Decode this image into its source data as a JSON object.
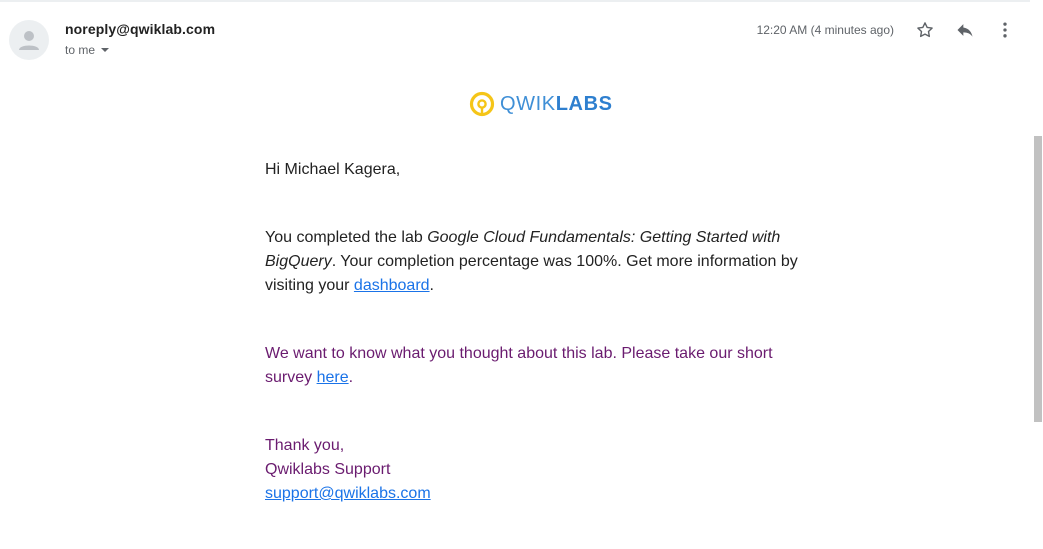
{
  "header": {
    "sender": "noreply@qwiklab.com",
    "recipient": "to me",
    "timestamp": "12:20 AM (4 minutes ago)",
    "icons": [
      "person-icon",
      "chevron-down-icon",
      "star-icon",
      "reply-icon",
      "more-vert-icon"
    ]
  },
  "logo": {
    "text_light": "QWIK",
    "text_bold": "LABS",
    "ring_color": "#f5c518",
    "text_color": "#3f8fd6"
  },
  "message": {
    "greeting": "Hi Michael Kagera,",
    "p1_start": "You completed the lab ",
    "lab_name": "Google Cloud Fundamentals: Getting Started with BigQuery",
    "p1_mid": ". Your completion percentage was 100%. Get more information by visiting your ",
    "dashboard_link": "dashboard",
    "p1_end": ".",
    "p2_start": "We want to know what you thought about this lab. Please take our short survey ",
    "survey_link": "here",
    "p2_end": ".",
    "sign_thanks": "Thank you,",
    "sign_team": "Qwiklabs Support",
    "support_email": "support@qwiklabs.com"
  },
  "colors": {
    "body_text": "#222222",
    "purple_text": "#6a1b6f",
    "link": "#1a73e8",
    "meta_text": "#5f6368"
  }
}
